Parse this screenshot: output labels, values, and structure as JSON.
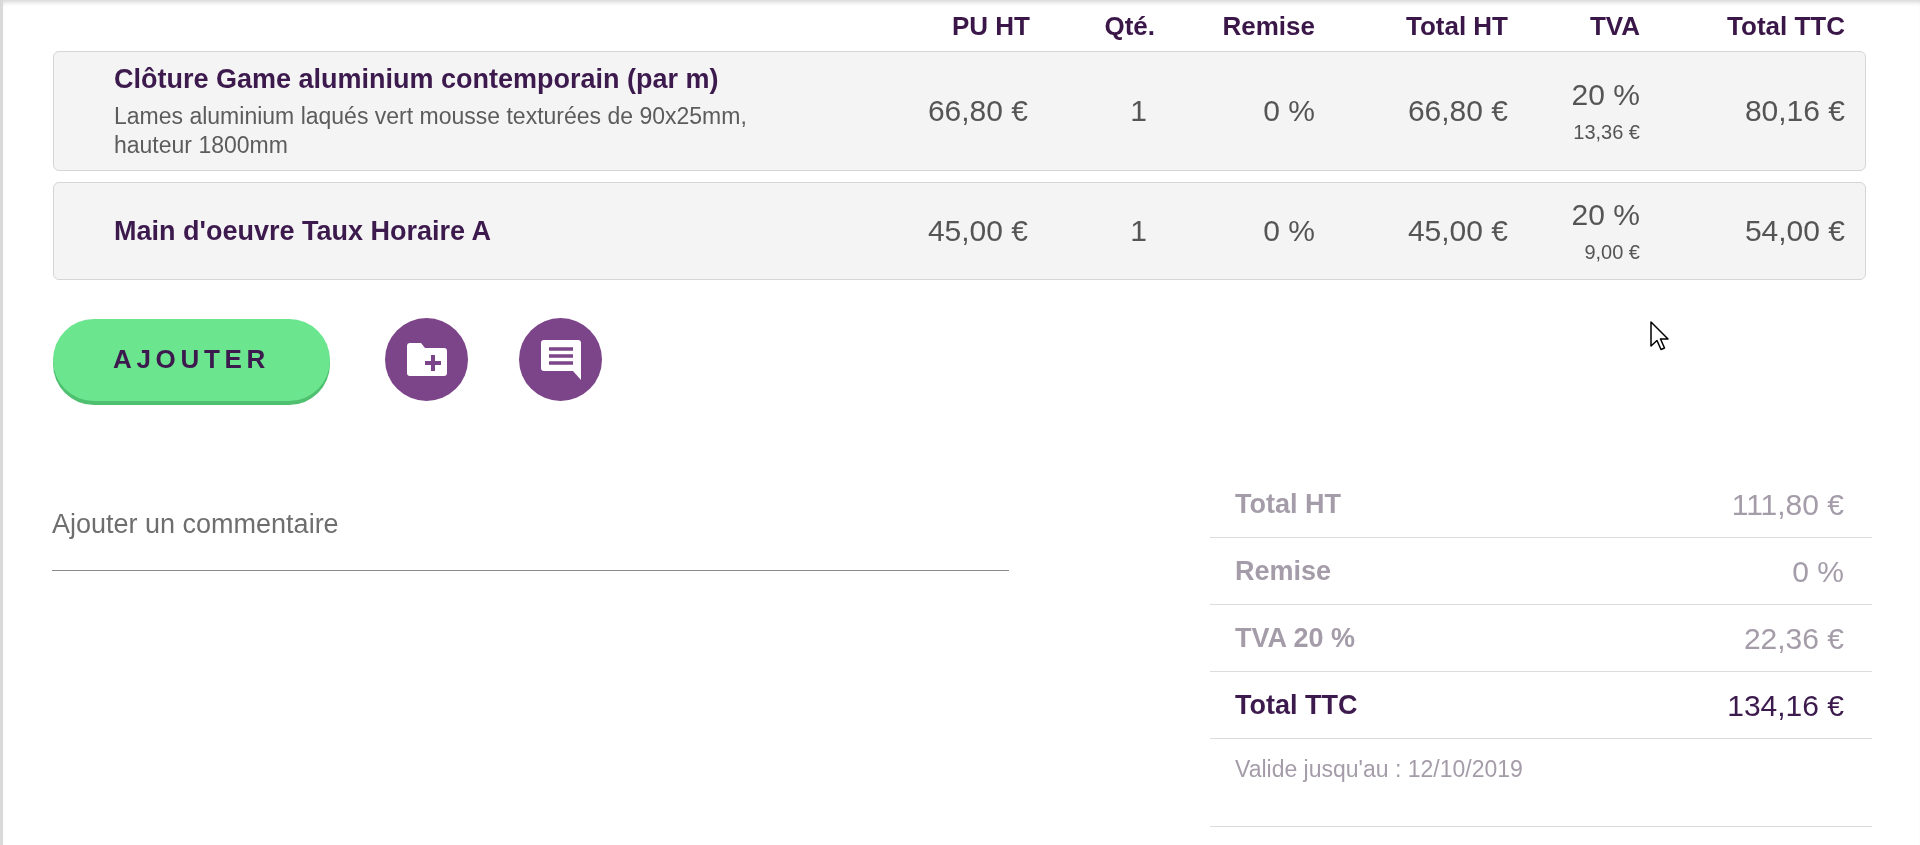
{
  "table": {
    "columns": [
      "PU HT",
      "Qté.",
      "Remise",
      "Total HT",
      "TVA",
      "Total TTC"
    ],
    "rows": [
      {
        "title": "Clôture Game aluminium contemporain (par m)",
        "description": "Lames aluminium laqués vert mousse texturées de 90x25mm, hauteur 1800mm",
        "unit_price": "66,80 €",
        "quantity": "1",
        "discount": "0 %",
        "total_ht": "66,80 €",
        "vat_rate": "20 %",
        "vat_amount": "13,36 €",
        "total_ttc": "80,16 €"
      },
      {
        "title": "Main d'oeuvre Taux Horaire A",
        "unit_price": "45,00 €",
        "quantity": "1",
        "discount": "0 %",
        "total_ht": "45,00 €",
        "vat_rate": "20 %",
        "vat_amount": "9,00 €",
        "total_ttc": "54,00 €"
      }
    ]
  },
  "actions": {
    "add_button": "AJOUTER"
  },
  "comment": {
    "placeholder": "Ajouter un commentaire"
  },
  "totals": {
    "rows": [
      {
        "kind": "subtotal",
        "label": "Total HT",
        "value": "111,80 €"
      },
      {
        "kind": "subtotal",
        "label": "Remise",
        "value": "0 %"
      },
      {
        "kind": "subtotal",
        "label": "TVA 20 %",
        "value": "22,36 €"
      },
      {
        "kind": "total",
        "label": "Total TTC",
        "value": "134,16 €"
      }
    ],
    "validity": "Valide jusqu'au : 12/10/2019"
  }
}
